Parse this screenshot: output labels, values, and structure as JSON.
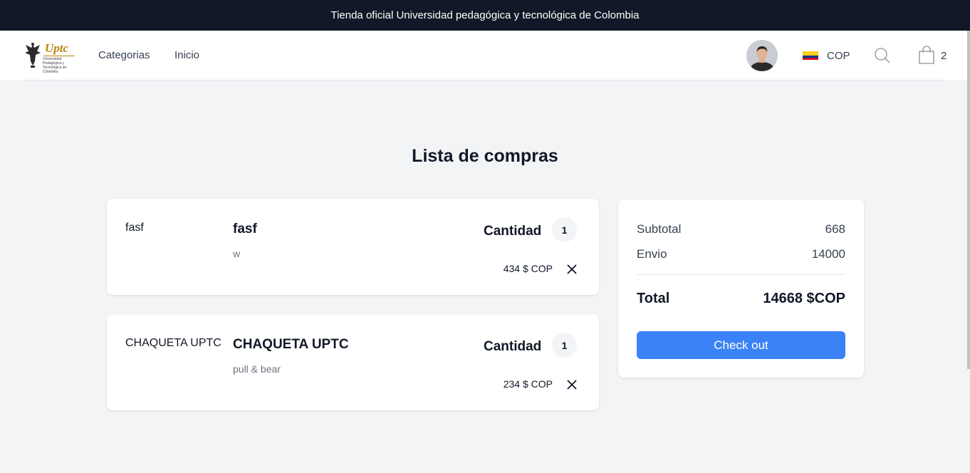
{
  "announcement": "Tienda oficial Universidad pedagógica y tecnológica de Colombia",
  "header": {
    "logo_text": "Uptc",
    "logo_subtext": "Universidad Pedagógica y Tecnológica de Colombia",
    "nav": [
      "Categorias",
      "Inicio"
    ],
    "currency": "COP",
    "cart_count": "2",
    "flag_colors": [
      "#fcd116",
      "#003893",
      "#ce1126"
    ]
  },
  "page_title": "Lista de compras",
  "cart_items": [
    {
      "image_alt": "fasf",
      "name": "fasf",
      "description": "w",
      "quantity_label": "Cantidad",
      "quantity": "1",
      "price": "434 $ COP"
    },
    {
      "image_alt": "CHAQUETA UPTC",
      "name": "CHAQUETA UPTC",
      "description": "pull & bear",
      "quantity_label": "Cantidad",
      "quantity": "1",
      "price": "234 $ COP"
    }
  ],
  "summary": {
    "subtotal_label": "Subtotal",
    "subtotal": "668",
    "shipping_label": "Envio",
    "shipping": "14000",
    "total_label": "Total",
    "total": "14668 $COP",
    "checkout_label": "Check out"
  },
  "colors": {
    "announce_bg": "#111827",
    "accent": "#3b82f6",
    "page_bg": "#f3f4f6"
  }
}
